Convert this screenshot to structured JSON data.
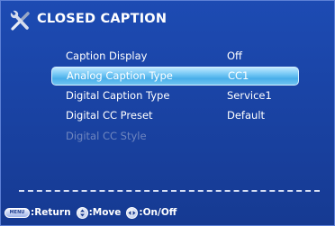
{
  "header": {
    "title": "CLOSED CAPTION",
    "icon": "tools-icon"
  },
  "menu": {
    "items": [
      {
        "label": "Caption Display",
        "value": "Off",
        "state": "normal"
      },
      {
        "label": "Analog Caption Type",
        "value": "CC1",
        "state": "selected"
      },
      {
        "label": "Digital Caption Type",
        "value": "Service1",
        "state": "normal"
      },
      {
        "label": "Digital CC Preset",
        "value": "Default",
        "state": "normal"
      },
      {
        "label": "Digital CC Style",
        "value": "",
        "state": "disabled"
      }
    ]
  },
  "footer": {
    "menu_key_text": "MENU",
    "return_label": ":Return",
    "move_label": ":Move",
    "onoff_label": ":On/Off"
  },
  "colors": {
    "background": "#1a44a6",
    "selected_highlight": "#49aee9",
    "disabled_text": "#6f86bf"
  }
}
